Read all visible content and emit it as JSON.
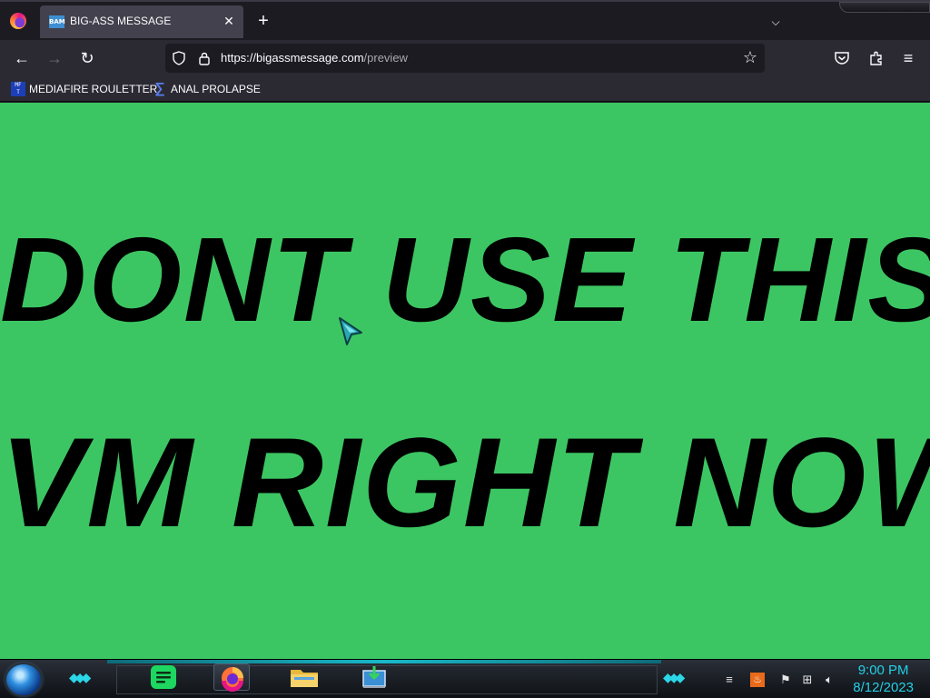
{
  "browser": {
    "tab": {
      "title": "BIG-ASS MESSAGE",
      "favicon_text": "BAM"
    },
    "urlbar": {
      "domain": "https://bigassmessage.com",
      "path": "/preview"
    },
    "bookmarks": [
      {
        "label": "MEDIAFIRE ROULETTER",
        "icon": "mft-icon"
      },
      {
        "label": "ANAL PROLAPSE",
        "icon": "sigma-icon"
      }
    ]
  },
  "page": {
    "background_color": "#3cc663",
    "message_line1": "DONT USE THIS",
    "message_line2": "VM RIGHT NOW"
  },
  "taskbar": {
    "apps": [
      "spotify-icon",
      "firefox-icon",
      "folder-icon",
      "installer-icon"
    ],
    "clock": {
      "time": "9:00 PM",
      "date": "8/12/2023"
    }
  }
}
